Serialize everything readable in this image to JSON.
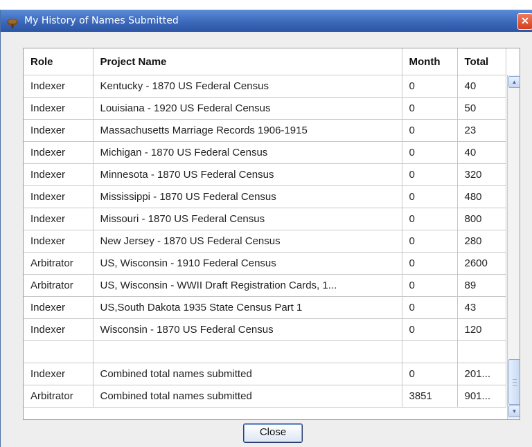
{
  "window": {
    "title": "My History of Names Submitted",
    "close_glyph": "✕"
  },
  "table": {
    "headers": [
      "Role",
      "Project Name",
      "Month",
      "Total"
    ],
    "rows": [
      [
        "Indexer",
        "Kentucky - 1870 US Federal Census",
        "0",
        "40"
      ],
      [
        "Indexer",
        "Louisiana - 1920 US Federal Census",
        "0",
        "50"
      ],
      [
        "Indexer",
        "Massachusetts Marriage Records 1906-1915",
        "0",
        "23"
      ],
      [
        "Indexer",
        "Michigan - 1870 US Federal Census",
        "0",
        "40"
      ],
      [
        "Indexer",
        "Minnesota - 1870 US Federal Census",
        "0",
        "320"
      ],
      [
        "Indexer",
        "Mississippi - 1870 US Federal Census",
        "0",
        "480"
      ],
      [
        "Indexer",
        "Missouri - 1870 US Federal Census",
        "0",
        "800"
      ],
      [
        "Indexer",
        "New Jersey - 1870 US Federal Census",
        "0",
        "280"
      ],
      [
        "Arbitrator",
        "US, Wisconsin - 1910 Federal Census",
        "0",
        "2600"
      ],
      [
        "Arbitrator",
        "US, Wisconsin - WWII Draft Registration Cards, 1...",
        "0",
        "89"
      ],
      [
        "Indexer",
        "US,South Dakota 1935 State Census Part 1",
        "0",
        "43"
      ],
      [
        "Indexer",
        "Wisconsin - 1870 US Federal Census",
        "0",
        "120"
      ],
      [
        "",
        "",
        "",
        ""
      ],
      [
        "Indexer",
        "Combined total names submitted",
        "0",
        "201..."
      ],
      [
        "Arbitrator",
        "Combined total names submitted",
        "3851",
        "901..."
      ]
    ]
  },
  "footer": {
    "close_label": "Close"
  },
  "icons": {
    "app": "tree-icon",
    "scroll_up": "arrow-up-icon",
    "scroll_down": "arrow-down-icon"
  },
  "colors": {
    "titlebar": "#3a66b8",
    "close_button": "#d2401e"
  }
}
